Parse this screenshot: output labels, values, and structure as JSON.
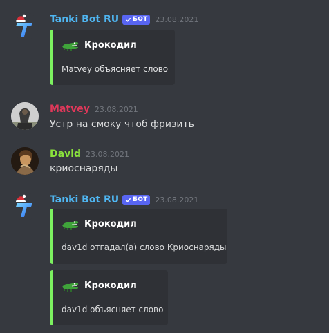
{
  "messages": [
    {
      "author": "Tanki Bot RU",
      "author_color": "#4fb6f2",
      "bot_tag": "БОТ",
      "timestamp": "23.08.2021",
      "embed": {
        "title": "Крокодил",
        "description": "Matvey объясняет слово",
        "color": "#7cf060"
      }
    },
    {
      "author": "Matvey",
      "author_color": "#e0385a",
      "timestamp": "23.08.2021",
      "text": "Устр на смоку чтоб фризить"
    },
    {
      "author": "David",
      "author_color": "#8ae33c",
      "timestamp": "23.08.2021",
      "text": "криоснаряды"
    },
    {
      "author": "Tanki Bot RU",
      "author_color": "#4fb6f2",
      "bot_tag": "БОТ",
      "timestamp": "23.08.2021",
      "embeds": [
        {
          "title": "Крокодил",
          "description": "dav1d отгадал(а) слово Криоснаряды",
          "color": "#7cf060"
        },
        {
          "title": "Крокодил",
          "description": "dav1d объясняет слово",
          "color": "#7cf060"
        }
      ]
    }
  ],
  "icons": {
    "bot_avatar": "tanki-logo-icon",
    "embed_author_icon": "crocodile-icon",
    "verified": "checkmark-icon"
  }
}
